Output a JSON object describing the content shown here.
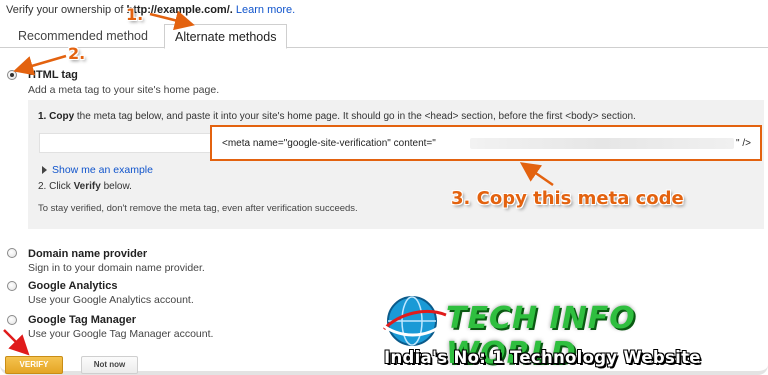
{
  "intro": {
    "prefix": "Verify your ownership of",
    "domain": " http://example.com/.",
    "learn_more": "Learn more."
  },
  "tabs": [
    {
      "label": "Recommended method",
      "active": false
    },
    {
      "label": "Alternate methods",
      "active": true
    }
  ],
  "methods": {
    "html_tag": {
      "title": "HTML tag",
      "desc": "Add a meta tag to your site's home page.",
      "selected": true
    },
    "domain_provider": {
      "title": "Domain name provider",
      "desc": "Sign in to your domain name provider."
    },
    "analytics": {
      "title": "Google Analytics",
      "desc": "Use your Google Analytics account."
    },
    "tag_manager": {
      "title": "Google Tag Manager",
      "desc": "Use your Google Tag Manager account."
    }
  },
  "panel": {
    "step1_num": "1.",
    "step1_bold": "Copy",
    "step1_rest": " the meta tag below, and paste it into your site's home page. It should go in the <head> section, before the first <body> section.",
    "meta_code": "<meta name=\"google-site-verification\" content=\"",
    "meta_end": "\" />",
    "show_example": "Show me an example",
    "step2_pre": "2. Click ",
    "step2_bold": "Verify",
    "step2_post": " below.",
    "stay_verified": "To stay verified, don't remove the meta tag, even after verification succeeds."
  },
  "annotations": {
    "one": "1.",
    "two": "2.",
    "three": "3.  Copy this meta code",
    "color": "#e3620f"
  },
  "buttons": {
    "verify": "VERIFY",
    "not_now": "Not now"
  },
  "watermark": {
    "title": "TECH INFO WORLD",
    "tagline": "India's No: 1 Technology Website"
  },
  "colors": {
    "link": "#1155cc",
    "verify_button": "#e4a525",
    "watermark_green": "#2fbf3f"
  }
}
